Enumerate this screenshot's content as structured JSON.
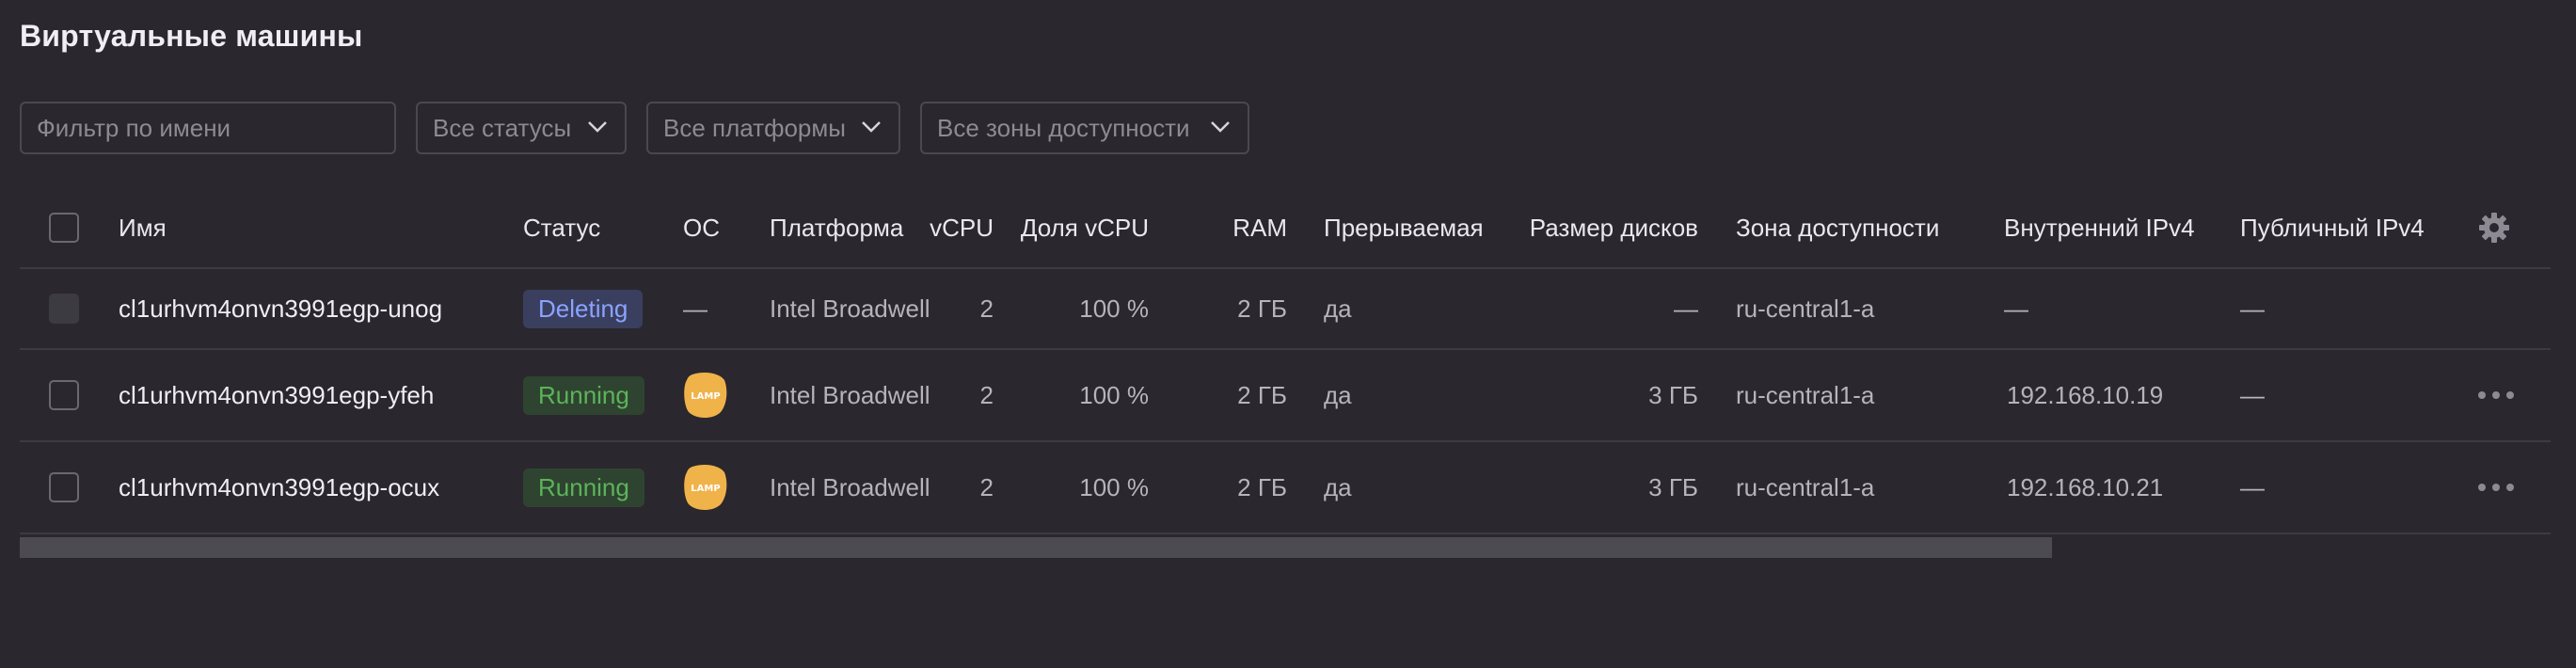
{
  "page": {
    "title": "Виртуальные машины"
  },
  "filters": {
    "name_placeholder": "Фильтр по имени",
    "status": "Все статусы",
    "platform": "Все платформы",
    "zone": "Все зоны доступности"
  },
  "table": {
    "columns": {
      "name": "Имя",
      "status": "Статус",
      "os": "ОС",
      "platform": "Платформа",
      "vcpu": "vCPU",
      "vcpu_share": "Доля vCPU",
      "ram": "RAM",
      "preemptible": "Прерываемая",
      "disk_size": "Размер дисков",
      "zone": "Зона доступности",
      "internal_ip": "Внутренний IPv4",
      "public_ip": "Публичный IPv4"
    },
    "rows": [
      {
        "name": "cl1urhvm4onvn3991egp-unog",
        "status": "Deleting",
        "os": "—",
        "platform": "Intel Broadwell",
        "vcpu": "2",
        "vcpu_share": "100 %",
        "ram": "2 ГБ",
        "preemptible": "да",
        "disk_size": "—",
        "zone": "ru-central1-a",
        "internal_ip": "—",
        "public_ip": "—"
      },
      {
        "name": "cl1urhvm4onvn3991egp-yfeh",
        "status": "Running",
        "os": "LAMP",
        "platform": "Intel Broadwell",
        "vcpu": "2",
        "vcpu_share": "100 %",
        "ram": "2 ГБ",
        "preemptible": "да",
        "disk_size": "3 ГБ",
        "zone": "ru-central1-a",
        "internal_ip": "192.168.10.19",
        "public_ip": "—"
      },
      {
        "name": "cl1urhvm4onvn3991egp-ocux",
        "status": "Running",
        "os": "LAMP",
        "platform": "Intel Broadwell",
        "vcpu": "2",
        "vcpu_share": "100 %",
        "ram": "2 ГБ",
        "preemptible": "да",
        "disk_size": "3 ГБ",
        "zone": "ru-central1-a",
        "internal_ip": "192.168.10.21",
        "public_ip": "—"
      }
    ]
  },
  "icons": {
    "settings": "gear-icon",
    "more": "more-horizontal-icon",
    "dropdown": "chevron-down-icon",
    "os_logo": "lamp-logo-icon"
  },
  "colors": {
    "background": "#2a282e",
    "status_running": "#5bb45a",
    "status_deleting": "#8aa3ff",
    "lamp_logo": "#f0b34a"
  }
}
